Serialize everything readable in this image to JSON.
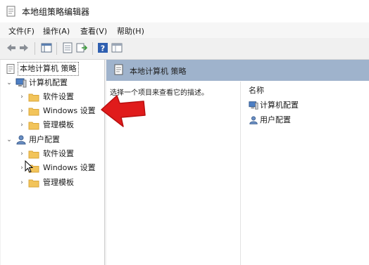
{
  "window": {
    "title": "本地组策略编辑器"
  },
  "menu": [
    {
      "label": "文件(F)"
    },
    {
      "label": "操作(A)"
    },
    {
      "label": "查看(V)"
    },
    {
      "label": "帮助(H)"
    }
  ],
  "toolbar": {
    "icons": [
      "back-arrow-icon",
      "forward-arrow-icon",
      "show-hide-console-tree-icon",
      "properties-icon",
      "export-list-icon",
      "help-icon",
      "view-icon"
    ]
  },
  "tree": {
    "root": "本地计算机 策略",
    "computer_config": "计算机配置",
    "computer_children": [
      "软件设置",
      "Windows 设置",
      "管理模板"
    ],
    "user_config": "用户配置",
    "user_children": [
      "软件设置",
      "Windows 设置",
      "管理模板"
    ]
  },
  "right": {
    "header": "本地计算机 策略",
    "description": "选择一个项目来查看它的描述。",
    "column_name": "名称",
    "items": [
      "计算机配置",
      "用户配置"
    ]
  },
  "colors": {
    "header_bg": "#9fb3cc",
    "annotation_arrow": "#e01b1b",
    "folder": "#f2c45a"
  }
}
